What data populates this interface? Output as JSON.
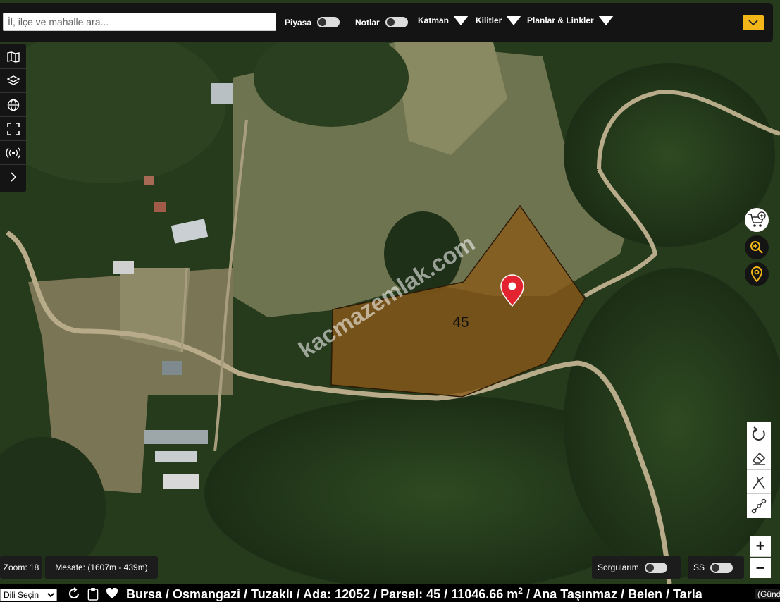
{
  "search": {
    "placeholder": "İl, ilçe ve mahalle ara..."
  },
  "toolbar": {
    "piyasa": "Piyasa",
    "notlar": "Notlar",
    "katman": "Katman",
    "kilitler": "Kilitler",
    "planlar": "Planlar & Linkler"
  },
  "map": {
    "parcel_label": "45",
    "watermark": "kacmazemlak.com"
  },
  "status": {
    "zoom": "Zoom: 18",
    "mesafe": "Mesafe: (1607m - 439m)",
    "sorgularim": "Sorgularım",
    "ss": "SS"
  },
  "zoom_controls": {
    "plus": "+",
    "minus": "−"
  },
  "footer": {
    "language": "Dili Seçin",
    "location_text": "Bursa / Osmangazi / Tuzaklı / Ada: 12052 / Parsel: 45 / 11046.66 m",
    "area_sup": "2",
    "location_tail": " / Ana Taşınmaz / Belen / Tarla",
    "gundem": "(Günd"
  },
  "colors": {
    "accent": "#f2b619",
    "parcel_fill": "#8a5a18",
    "marker": "#e3232f"
  }
}
